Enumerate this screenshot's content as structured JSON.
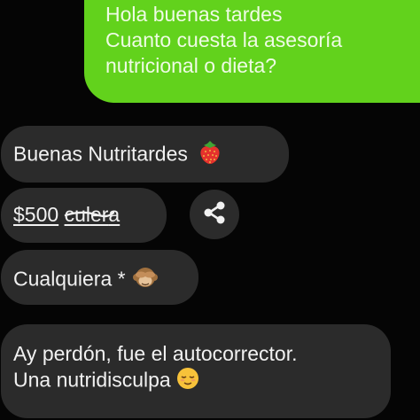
{
  "sent_message": {
    "lines": [
      "Hola buenas tardes",
      "Cuanto cuesta la asesoría",
      "nutricional o dieta?"
    ]
  },
  "received_messages": {
    "greeting": {
      "text": "Buenas Nutritardes",
      "emoji": "strawberry-icon"
    },
    "price": {
      "amount": "$500",
      "word_prefix": "cul",
      "word_strike": "er",
      "word_suffix": "a"
    },
    "reply": {
      "text": "Cualquiera *",
      "emoji": "see-no-evil-monkey-icon"
    },
    "apology": {
      "lines": [
        "Ay perdón, fue el autocorrector.",
        "Una nutridisculpa"
      ],
      "emoji": "relieved-face-icon"
    }
  },
  "share_button": {
    "icon": "share-icon"
  },
  "colors": {
    "sent_bubble": "#62d21c",
    "received_bubble": "#2b2b2b",
    "background": "#050505",
    "text": "#f1f1f1"
  }
}
